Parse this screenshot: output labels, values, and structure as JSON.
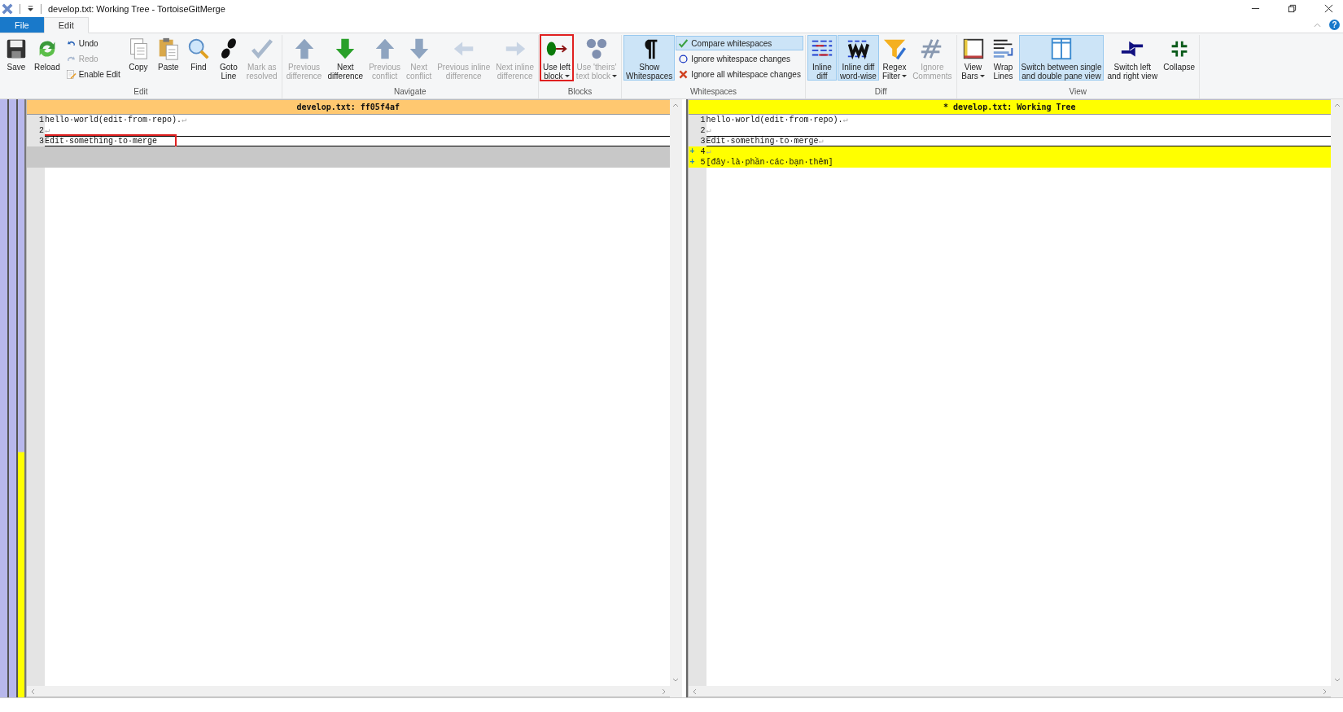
{
  "window": {
    "title": "develop.txt: Working Tree - TortoiseGitMerge",
    "help": "?"
  },
  "tabs": [
    {
      "label": "File",
      "kind": "backstage",
      "selected": false
    },
    {
      "label": "Edit",
      "kind": "tab",
      "selected": true
    }
  ],
  "ribbon": {
    "groups": [
      {
        "label": "Edit",
        "items": [
          {
            "kind": "large",
            "label_lines": [
              "Save"
            ],
            "disabled": false,
            "selected": false
          },
          {
            "kind": "large",
            "label_lines": [
              "Reload"
            ],
            "disabled": false,
            "selected": false
          },
          {
            "kind": "stack",
            "items": [
              {
                "label": "Undo",
                "disabled": false,
                "selected": false
              },
              {
                "label": "Redo",
                "disabled": true,
                "selected": false
              },
              {
                "label": "Enable Edit",
                "disabled": false,
                "selected": false
              }
            ]
          },
          {
            "kind": "large",
            "label_lines": [
              "Copy"
            ],
            "disabled": false,
            "selected": false
          },
          {
            "kind": "large",
            "label_lines": [
              "Paste"
            ],
            "disabled": false,
            "selected": false
          },
          {
            "kind": "large",
            "label_lines": [
              "Find"
            ],
            "disabled": false,
            "selected": false
          },
          {
            "kind": "large",
            "label_lines": [
              "Goto",
              "Line"
            ],
            "disabled": false,
            "selected": false
          },
          {
            "kind": "large",
            "label_lines": [
              "Mark as",
              "resolved"
            ],
            "disabled": true,
            "selected": false
          }
        ]
      },
      {
        "label": "Navigate",
        "items": [
          {
            "kind": "large",
            "label_lines": [
              "Previous",
              "difference"
            ],
            "disabled": true,
            "selected": false
          },
          {
            "kind": "large",
            "label_lines": [
              "Next",
              "difference"
            ],
            "disabled": false,
            "selected": false
          },
          {
            "kind": "large",
            "label_lines": [
              "Previous",
              "conflict"
            ],
            "disabled": true,
            "selected": false
          },
          {
            "kind": "large",
            "label_lines": [
              "Next",
              "conflict"
            ],
            "disabled": true,
            "selected": false
          },
          {
            "kind": "large",
            "label_lines": [
              "Previous inline",
              "difference"
            ],
            "disabled": true,
            "selected": false
          },
          {
            "kind": "large",
            "label_lines": [
              "Next inline",
              "difference"
            ],
            "disabled": true,
            "selected": false
          }
        ]
      },
      {
        "label": "Blocks",
        "items": [
          {
            "kind": "large",
            "label_lines": [
              "Use left",
              "block"
            ],
            "dropdown": true,
            "annotated": true,
            "disabled": false,
            "selected": false
          },
          {
            "kind": "large",
            "label_lines": [
              "Use 'theirs'",
              "text block"
            ],
            "dropdown": true,
            "disabled": true,
            "selected": false
          }
        ]
      },
      {
        "label": "Whitespaces",
        "items": [
          {
            "kind": "large",
            "label_lines": [
              "Show",
              "Whitespaces"
            ],
            "disabled": false,
            "selected": true
          },
          {
            "kind": "stack",
            "items": [
              {
                "label": "Compare whitespaces",
                "disabled": false,
                "selected": true
              },
              {
                "label": "Ignore whitespace changes",
                "disabled": false,
                "selected": false
              },
              {
                "label": "Ignore all whitespace changes",
                "disabled": false,
                "selected": false
              }
            ]
          }
        ]
      },
      {
        "label": "Diff",
        "items": [
          {
            "kind": "large",
            "label_lines": [
              "Inline",
              "diff"
            ],
            "disabled": false,
            "selected": true
          },
          {
            "kind": "large",
            "label_lines": [
              "Inline diff",
              "word-wise"
            ],
            "disabled": false,
            "selected": true
          },
          {
            "kind": "large",
            "label_lines": [
              "Regex",
              "Filter"
            ],
            "dropdown": true,
            "disabled": false,
            "selected": false
          },
          {
            "kind": "large",
            "label_lines": [
              "Ignore",
              "Comments"
            ],
            "disabled": true,
            "selected": false
          }
        ]
      },
      {
        "label": "View",
        "items": [
          {
            "kind": "large",
            "label_lines": [
              "View",
              "Bars"
            ],
            "dropdown": true,
            "disabled": false,
            "selected": false
          },
          {
            "kind": "large",
            "label_lines": [
              "Wrap",
              "Lines"
            ],
            "disabled": false,
            "selected": false
          },
          {
            "kind": "large",
            "label_lines": [
              "Switch between single",
              "and double pane view"
            ],
            "disabled": false,
            "selected": true
          },
          {
            "kind": "large",
            "label_lines": [
              "Switch left",
              "and right view"
            ],
            "disabled": false,
            "selected": false
          },
          {
            "kind": "large",
            "label_lines": [
              "Collapse"
            ],
            "disabled": false,
            "selected": false
          }
        ]
      }
    ]
  },
  "panes": [
    {
      "title": "develop.txt: ff05f4af",
      "kind": "base",
      "lines": [
        {
          "kind": "normal",
          "number": "1",
          "text": "hello·world(edit·from·repo).",
          "eol": "↵"
        },
        {
          "kind": "normal",
          "number": "2",
          "eol": "↵"
        },
        {
          "kind": "current",
          "number": "3",
          "text": "Edit·something·to·merge",
          "annotated": true
        },
        {
          "kind": "empty"
        },
        {
          "kind": "empty"
        }
      ]
    },
    {
      "title": "* develop.txt: Working Tree",
      "kind": "modified",
      "lines": [
        {
          "kind": "normal",
          "number": "1",
          "text": "hello·world(edit·from·repo).",
          "eol": "↵"
        },
        {
          "kind": "normal",
          "number": "2",
          "eol": "↵"
        },
        {
          "kind": "current",
          "number": "3",
          "text": "Edit·something·to·merge",
          "eol": "↵"
        },
        {
          "kind": "added",
          "marker": "+",
          "number": "4",
          "eol": "↵"
        },
        {
          "kind": "added",
          "marker": "+",
          "number": "5",
          "text": "[đây·là·phần·các·bạn·thêm]"
        }
      ]
    }
  ]
}
